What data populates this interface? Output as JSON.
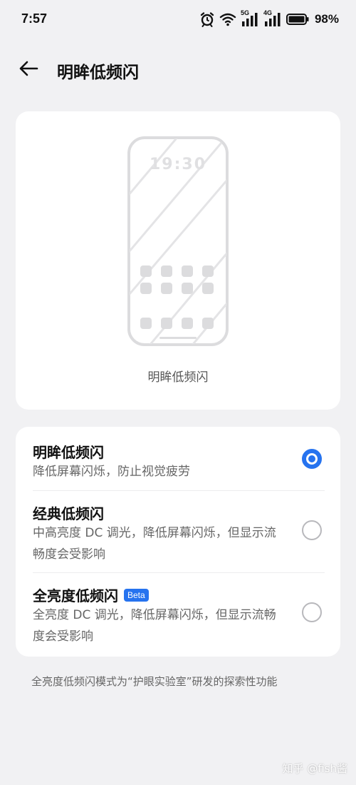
{
  "status_bar": {
    "time": "7:57",
    "signal_1_label": "5G",
    "signal_2_label": "4G",
    "battery": "98%"
  },
  "header": {
    "title": "明眸低频闪"
  },
  "preview": {
    "clock": "19:30",
    "caption": "明眸低频闪"
  },
  "options": [
    {
      "title": "明眸低频闪",
      "description": "降低屏幕闪烁，防止视觉疲劳",
      "selected": true
    },
    {
      "title": "经典低频闪",
      "description": "中高亮度 DC 调光，降低屏幕闪烁，但显示流畅度会受影响",
      "selected": false
    },
    {
      "title": "全亮度低频闪",
      "badge": "Beta",
      "description": "全亮度 DC 调光，降低屏幕闪烁，但显示流畅度会受影响",
      "selected": false
    }
  ],
  "footnote": "全亮度低频闪模式为“护眼实验室”研发的探索性功能",
  "watermark": "知乎 @fish酱",
  "colors": {
    "accent": "#2673ef",
    "background": "#f1f1f3",
    "card": "#ffffff"
  }
}
